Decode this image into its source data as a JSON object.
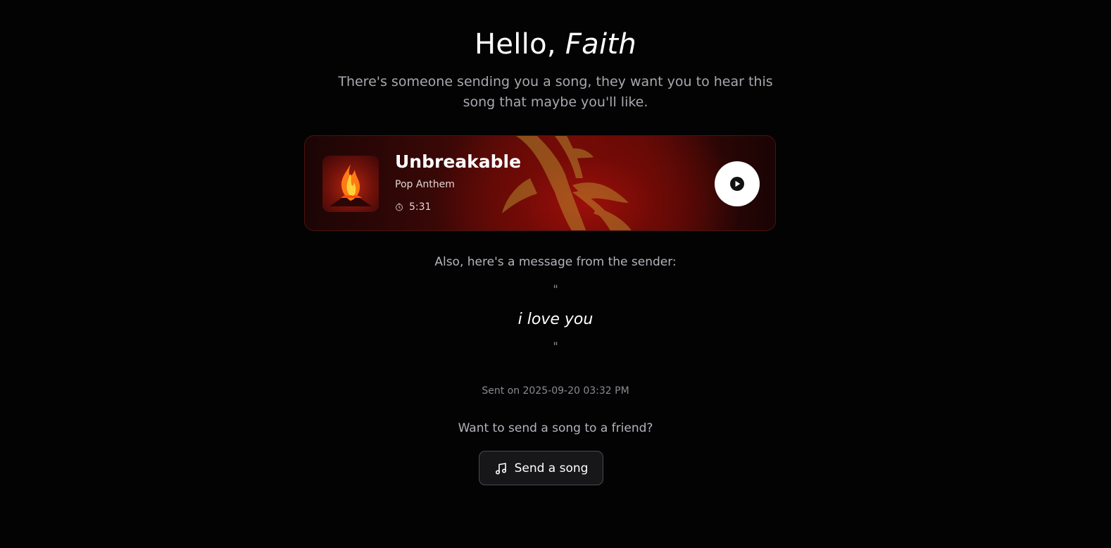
{
  "greeting": {
    "hello": "Hello,",
    "name": "Faith"
  },
  "intro": {
    "line1": "There's someone sending you a song, they want you to hear this",
    "line2": "song that maybe you'll like."
  },
  "song": {
    "title": "Unbreakable",
    "genre": "Pop Anthem",
    "duration": "5:31",
    "play_icon": "play-icon",
    "clock_icon": "clock-icon",
    "artwork": "flame-artwork"
  },
  "message": {
    "intro": "Also, here's a message from the sender:",
    "open_quote": "\"",
    "text": "i love you",
    "close_quote": "\""
  },
  "sent_on": "Sent on 2025-09-20 03:32 PM",
  "cta": {
    "prompt": "Want to send a song to a friend?",
    "button_label": "Send a song",
    "button_icon": "music-note-icon"
  },
  "colors": {
    "background": "#030303",
    "card_accent": "#9b0f0a",
    "muted_text": "#a8a8b0",
    "button_bg": "#17171a"
  }
}
